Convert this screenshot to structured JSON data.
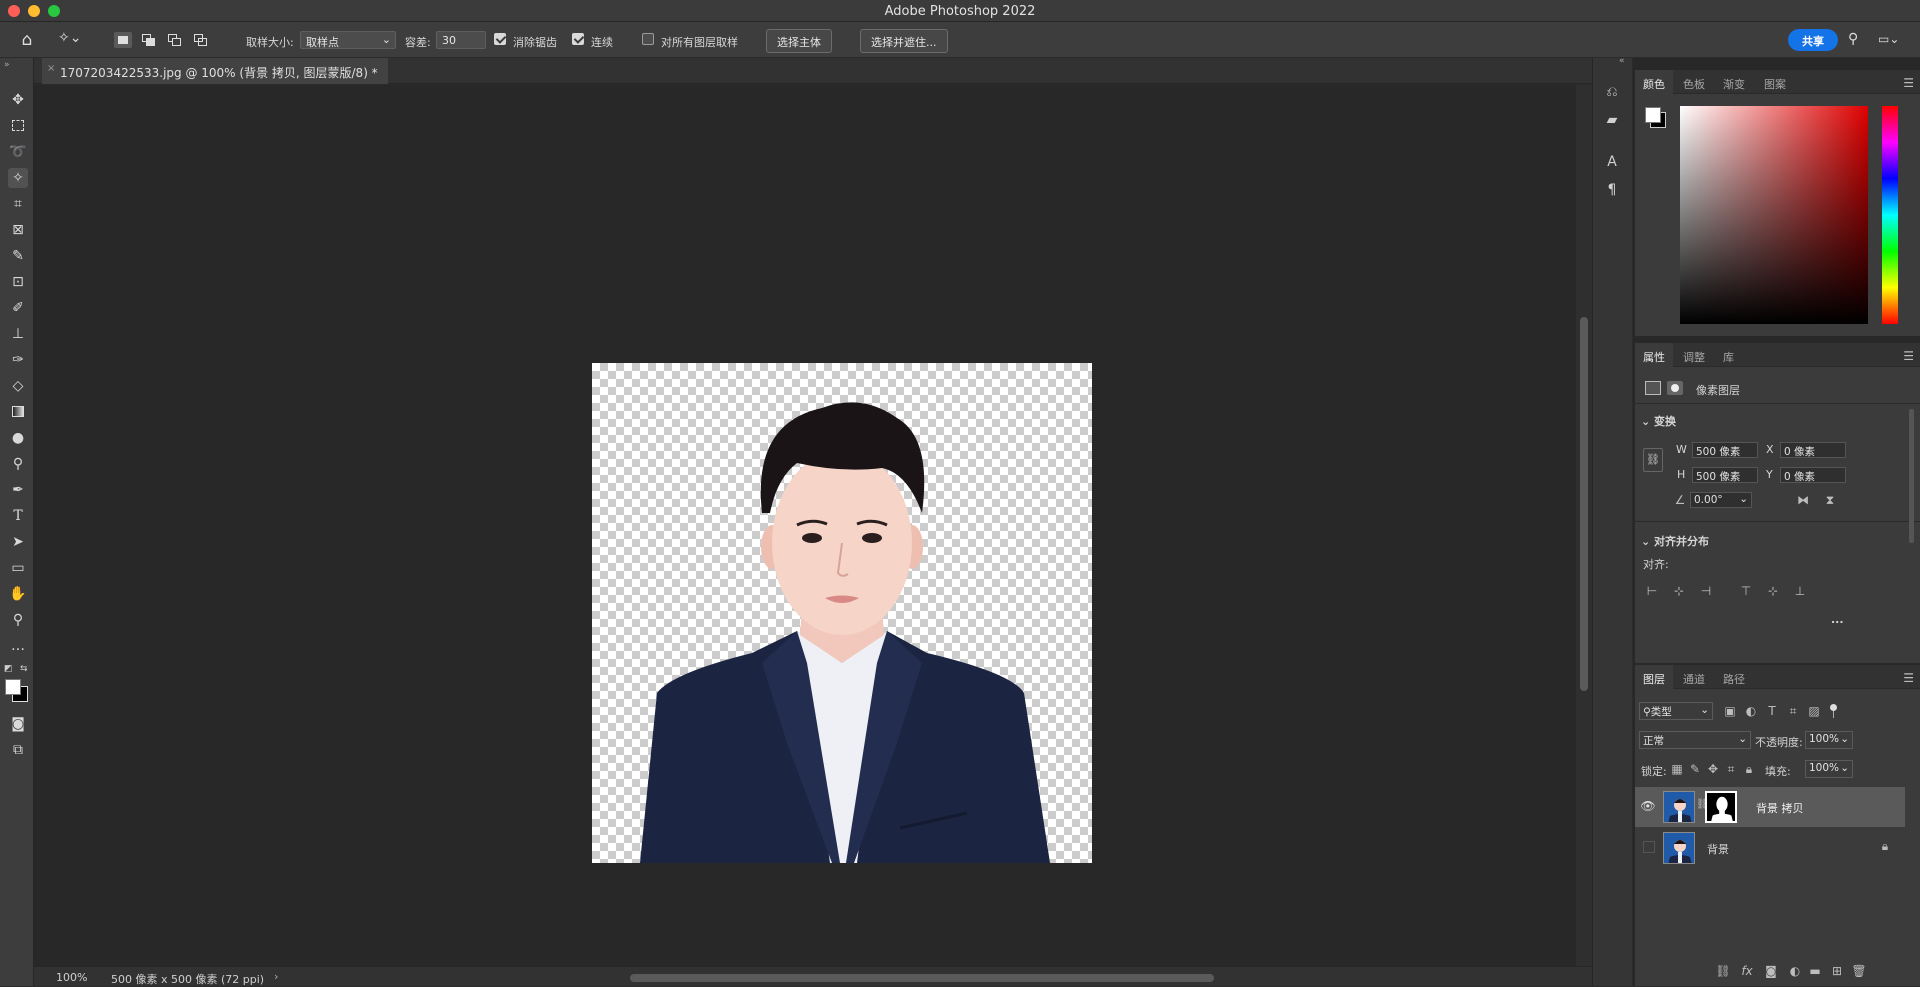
{
  "app": {
    "title": "Adobe Photoshop 2022"
  },
  "options_bar": {
    "sample_size_label": "取样大小:",
    "sample_size_value": "取样点",
    "tolerance_label": "容差:",
    "tolerance_value": "30",
    "anti_alias_label": "消除锯齿",
    "anti_alias_checked": true,
    "contiguous_label": "连续",
    "contiguous_checked": true,
    "sample_all_label": "对所有图层取样",
    "sample_all_checked": false,
    "select_subject_label": "选择主体",
    "select_mask_label": "选择并遮住...",
    "share_label": "共享"
  },
  "document": {
    "tab_title": "1707203422533.jpg @ 100% (背景 拷贝, 图层蒙版/8) *",
    "zoom": "100%",
    "info": "500 像素 x 500 像素 (72 ppi)"
  },
  "color_panel": {
    "tabs": [
      "颜色",
      "色板",
      "渐变",
      "图案"
    ],
    "active_tab": "颜色"
  },
  "properties_panel": {
    "tabs": [
      "属性",
      "调整",
      "库"
    ],
    "active_tab": "属性",
    "layer_type": "像素图层",
    "transform_label": "变换",
    "w_label": "W",
    "w_value": "500 像素",
    "h_label": "H",
    "h_value": "500 像素",
    "x_label": "X",
    "x_value": "0 像素",
    "y_label": "Y",
    "y_value": "0 像素",
    "angle_value": "0.00°",
    "align_section_label": "对齐并分布",
    "align_label": "对齐:",
    "more": "..."
  },
  "layers_panel": {
    "tabs": [
      "图层",
      "通道",
      "路径"
    ],
    "active_tab": "图层",
    "filter_kind": "类型",
    "blend_mode": "正常",
    "opacity_label": "不透明度:",
    "opacity_value": "100%",
    "lock_label": "锁定:",
    "fill_label": "填充:",
    "fill_value": "100%",
    "layers": [
      {
        "name": "背景 拷贝",
        "visible": true,
        "selected": true,
        "has_mask": true
      },
      {
        "name": "背景",
        "visible": false,
        "selected": false,
        "locked": true
      }
    ]
  },
  "colors": {
    "accent": "#1473e6",
    "panel_bg": "#3b3b3b",
    "canvas_bg": "#282828"
  }
}
